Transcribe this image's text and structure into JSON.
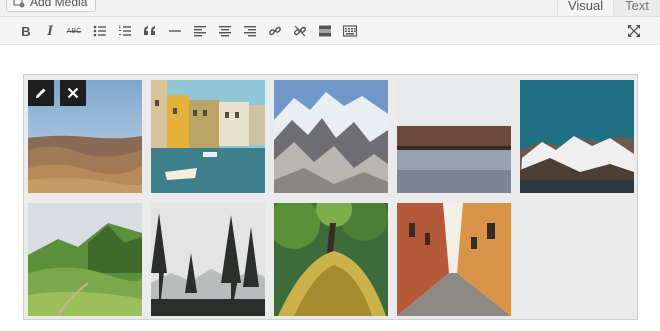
{
  "header": {
    "add_media_label": "Add Media",
    "tabs": [
      {
        "label": "Visual",
        "active": true
      },
      {
        "label": "Text",
        "active": false
      }
    ]
  },
  "toolbar": {
    "buttons": [
      {
        "name": "bold",
        "glyph": "B"
      },
      {
        "name": "italic",
        "glyph": "I"
      },
      {
        "name": "strikethrough",
        "glyph": "ABC"
      }
    ]
  },
  "gallery": {
    "images": [
      "desert-landscape",
      "canal-houses",
      "snowy-mountains",
      "lake-shore",
      "mountain-coast",
      "green-hills",
      "misty-forest",
      "tree-trunk",
      "narrow-street"
    ]
  },
  "colors": {
    "toolbar_bg": "#f5f5f5",
    "gallery_bg": "#ebebeb",
    "overlay_button": "#1e1e1e"
  }
}
